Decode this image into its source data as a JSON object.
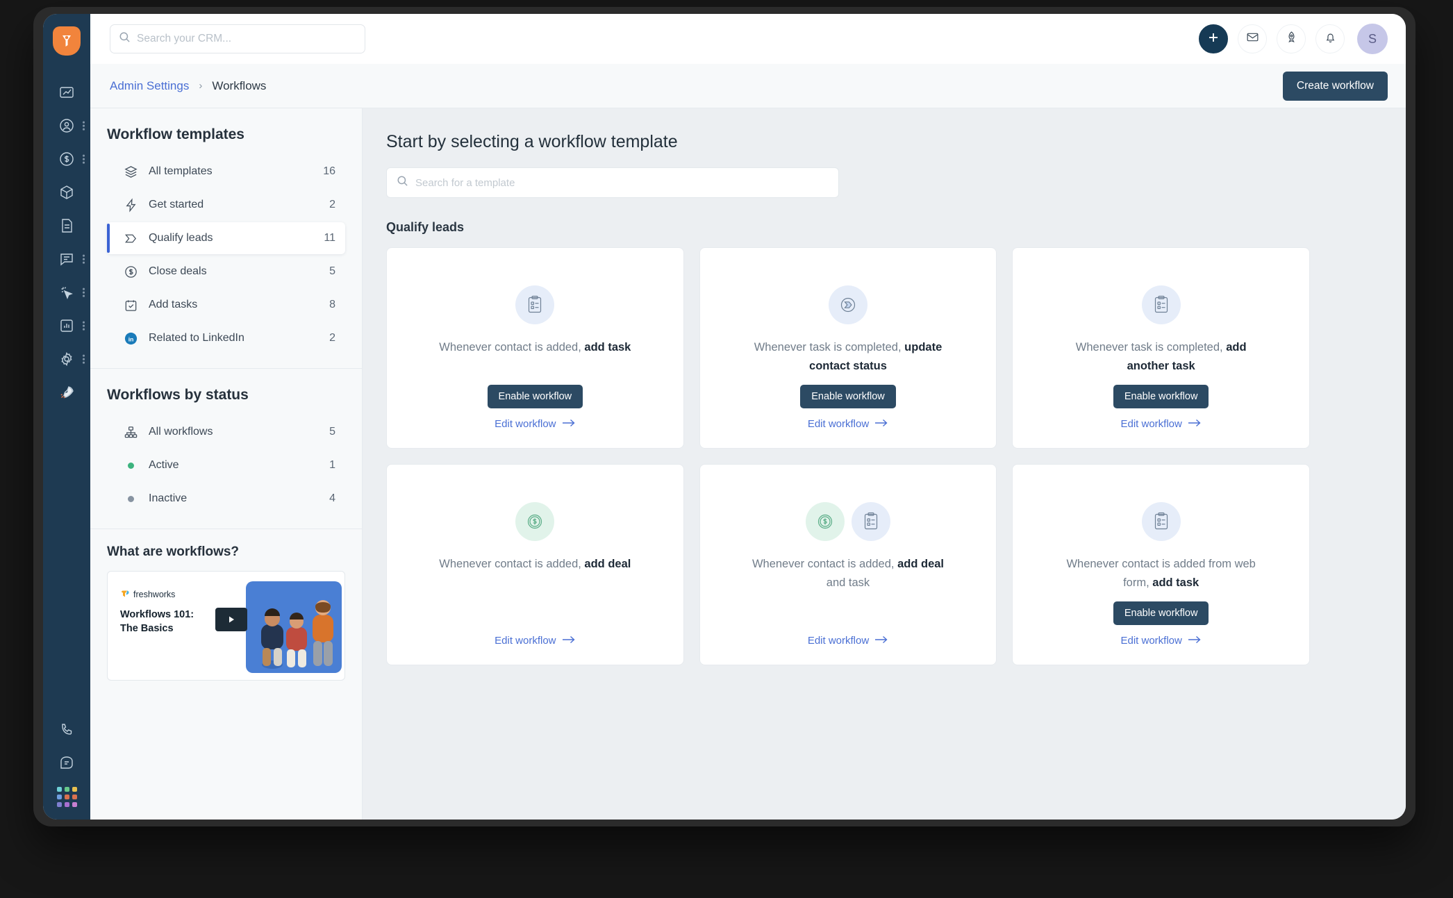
{
  "rail": {
    "logo_name": "freshworks-crm-logo",
    "items": [
      {
        "name": "dashboard-icon",
        "has_menu": false
      },
      {
        "name": "contacts-icon",
        "has_menu": true
      },
      {
        "name": "deals-icon",
        "has_menu": true
      },
      {
        "name": "products-icon",
        "has_menu": false
      },
      {
        "name": "documents-icon",
        "has_menu": false
      },
      {
        "name": "chat-icon",
        "has_menu": true
      },
      {
        "name": "campaigns-icon",
        "has_menu": true
      },
      {
        "name": "reports-icon",
        "has_menu": true
      },
      {
        "name": "settings-gear-icon",
        "has_menu": true
      },
      {
        "name": "rocket-icon",
        "has_menu": false
      }
    ],
    "bottom_items": [
      {
        "name": "phone-icon"
      },
      {
        "name": "chat-bubble-icon"
      },
      {
        "name": "app-grid-icon"
      }
    ],
    "app_grid_colors": [
      "#6ecfd6",
      "#67c98a",
      "#e8c04f",
      "#6f9ee0",
      "#d9714f",
      "#d9714f",
      "#7f7fd0",
      "#a86fd0",
      "#c77fd0"
    ]
  },
  "topbar": {
    "search": {
      "placeholder": "Search your CRM...",
      "value": ""
    },
    "actions": [
      {
        "name": "add-button",
        "icon": "plus-icon"
      },
      {
        "name": "email-button",
        "icon": "envelope-icon"
      },
      {
        "name": "onboarding-button",
        "icon": "rocket-icon"
      },
      {
        "name": "notifications-button",
        "icon": "bell-icon"
      }
    ],
    "avatar_initial": "S"
  },
  "breadcrumb": {
    "parent": "Admin Settings",
    "separator": "›",
    "current": "Workflows",
    "create_button": "Create workflow"
  },
  "sidebar": {
    "templates_title": "Workflow templates",
    "template_items": [
      {
        "label": "All templates",
        "count": "16",
        "icon": "layers-icon",
        "active": false
      },
      {
        "label": "Get started",
        "count": "2",
        "icon": "bolt-icon",
        "active": false
      },
      {
        "label": "Qualify leads",
        "count": "11",
        "icon": "chevron-flag-icon",
        "active": true
      },
      {
        "label": "Close deals",
        "count": "5",
        "icon": "dollar-circle-icon",
        "active": false
      },
      {
        "label": "Add tasks",
        "count": "8",
        "icon": "task-check-icon",
        "active": false
      },
      {
        "label": "Related to LinkedIn",
        "count": "2",
        "icon": "linkedin-icon",
        "active": false
      }
    ],
    "status_title": "Workflows by status",
    "status_items": [
      {
        "label": "All workflows",
        "count": "5",
        "icon": "sitemap-icon",
        "color": ""
      },
      {
        "label": "Active",
        "count": "1",
        "icon": "status-dot",
        "color": "#3cb37e"
      },
      {
        "label": "Inactive",
        "count": "4",
        "icon": "status-dot",
        "color": "#8793a1"
      }
    ],
    "promo": {
      "title": "What are workflows?",
      "brand": "freshworks",
      "heading_line1": "Workflows 101:",
      "heading_line2": "The Basics",
      "play_label": "play-button"
    }
  },
  "main": {
    "heading": "Start by selecting a workflow template",
    "search": {
      "placeholder": "Search for a template",
      "value": ""
    },
    "group_title": "Qualify leads",
    "enable_label": "Enable workflow",
    "edit_label": "Edit workflow",
    "cards": [
      {
        "icons": [
          "clipboard-task-icon"
        ],
        "icon_colors": [
          "blue"
        ],
        "text_prefix": "Whenever contact is added, ",
        "text_bold": "add task",
        "text_suffix": "",
        "has_enable": true
      },
      {
        "icons": [
          "chevron-flag-icon"
        ],
        "icon_colors": [
          "blue"
        ],
        "text_prefix": "Whenever task is completed, ",
        "text_bold": "update contact status",
        "text_suffix": "",
        "has_enable": true
      },
      {
        "icons": [
          "clipboard-task-icon"
        ],
        "icon_colors": [
          "blue"
        ],
        "text_prefix": "Whenever task is completed, ",
        "text_bold": "add another task",
        "text_suffix": "",
        "has_enable": true
      },
      {
        "icons": [
          "dollar-circle-icon"
        ],
        "icon_colors": [
          "green"
        ],
        "text_prefix": "Whenever contact is added, ",
        "text_bold": "add deal",
        "text_suffix": "",
        "has_enable": false
      },
      {
        "icons": [
          "dollar-circle-icon",
          "clipboard-task-icon"
        ],
        "icon_colors": [
          "green",
          "blue"
        ],
        "text_prefix": "Whenever contact is added, ",
        "text_bold": "add deal",
        "text_suffix": " and task",
        "has_enable": false
      },
      {
        "icons": [
          "clipboard-task-icon"
        ],
        "icon_colors": [
          "blue"
        ],
        "text_prefix": "Whenever contact is added from web form, ",
        "text_bold": "add task",
        "text_suffix": "",
        "has_enable": true
      }
    ]
  },
  "colors": {
    "rail_bg": "#1e3a52",
    "brand_orange": "#f1843c",
    "accent_blue": "#4a6fd4",
    "button_navy": "#2c4a63",
    "active_bar": "#3b63d4",
    "page_bg": "#eceff2",
    "status_active": "#3cb37e",
    "status_inactive": "#8793a1"
  }
}
